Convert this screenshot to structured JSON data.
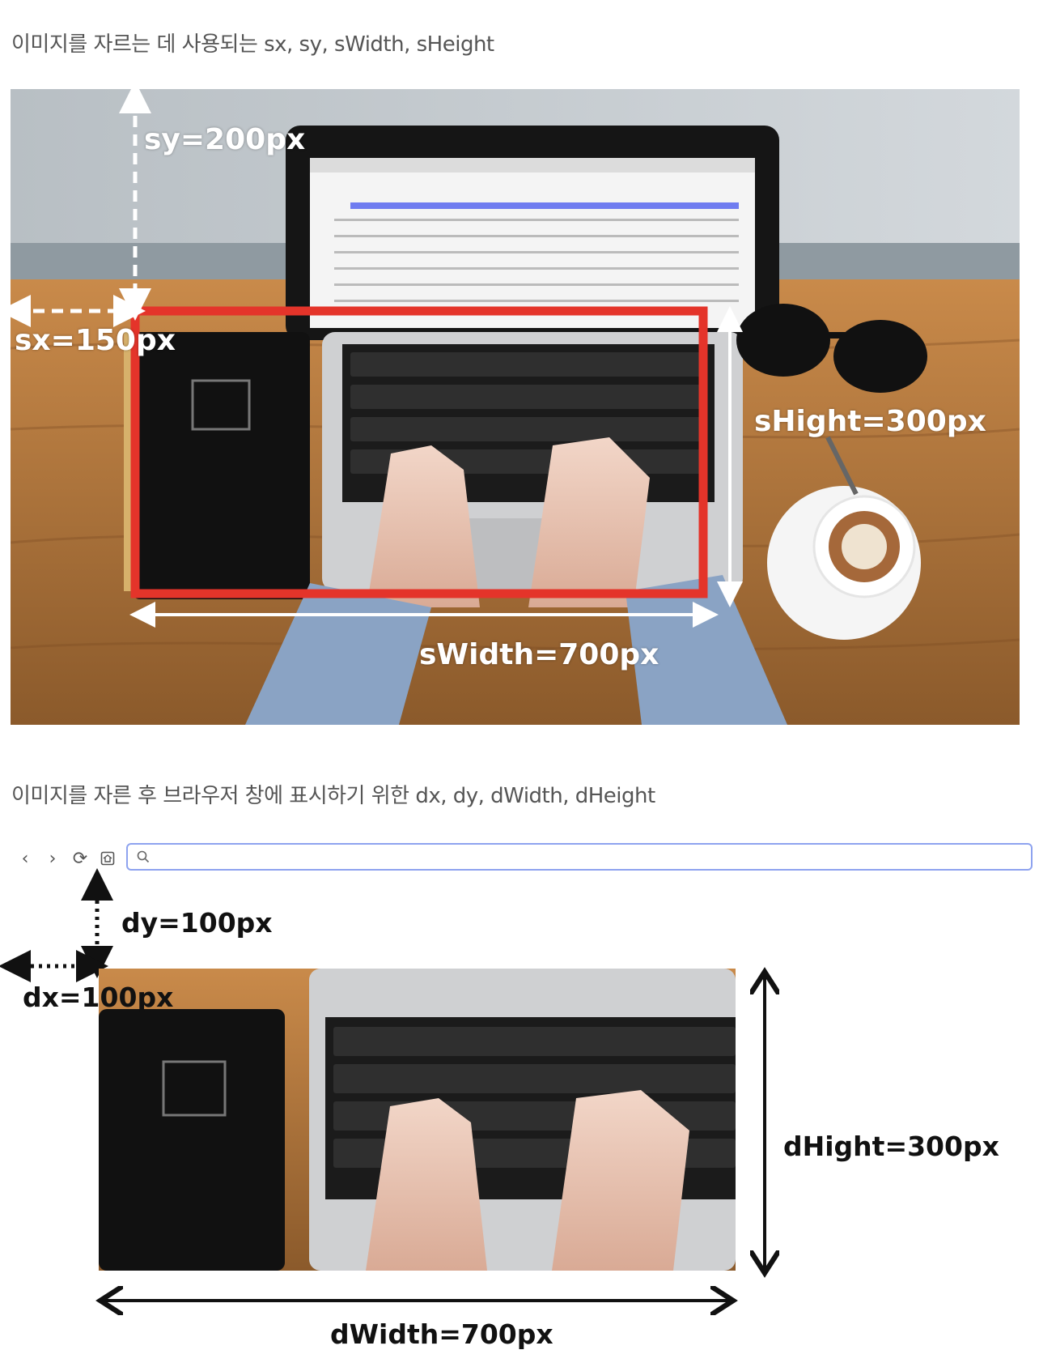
{
  "captions": {
    "top": "이미지를 자르는 데 사용되는 sx, sy, sWidth, sHeight",
    "bottom": "이미지를 자른 후 브라우저 창에 표시하기 위한 dx, dy, dWidth, dHeight"
  },
  "source_labels": {
    "sy": "sy=200px",
    "sx": "sx=150px",
    "sWidth": "sWidth=700px",
    "sHeight": "sHight=300px"
  },
  "dest_labels": {
    "dy": "dy=100px",
    "dx": "dx=100px",
    "dWidth": "dWidth=700px",
    "dHeight": "dHight=300px"
  },
  "toolbar": {
    "back_icon": "chevron-left-icon",
    "forward_icon": "chevron-right-icon",
    "reload_icon": "reload-icon",
    "home_icon": "home-icon",
    "search_icon": "search-icon",
    "url_value": ""
  },
  "colors": {
    "crop_rect": "#e4342a",
    "url_border": "#8ea3ef",
    "source_arrows": "#ffffff",
    "dest_arrows": "#111111"
  }
}
